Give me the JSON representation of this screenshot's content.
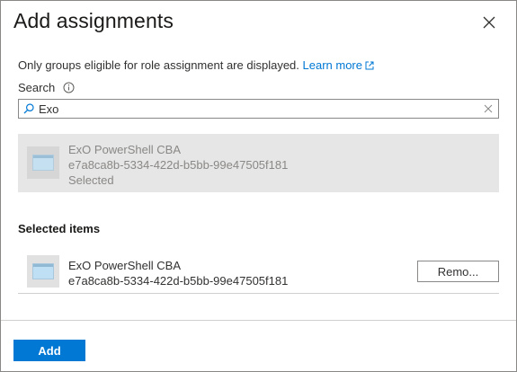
{
  "panel": {
    "title": "Add assignments"
  },
  "info": {
    "text": "Only groups eligible for role assignment are displayed.",
    "link_label": "Learn more"
  },
  "search": {
    "label": "Search",
    "value": "Exo"
  },
  "results": [
    {
      "name": "ExO PowerShell CBA",
      "id": "e7a8ca8b-5334-422d-b5bb-99e47505f181",
      "status": "Selected"
    }
  ],
  "selected_section": {
    "title": "Selected items",
    "items": [
      {
        "name": "ExO PowerShell CBA",
        "id": "e7a8ca8b-5334-422d-b5bb-99e47505f181",
        "remove_label": "Remo..."
      }
    ]
  },
  "footer": {
    "add_label": "Add"
  },
  "colors": {
    "accent": "#0078d4",
    "card_background": "#e6e6e6",
    "border": "#8a8886"
  },
  "icons": [
    "close-icon",
    "external-link-icon",
    "info-icon",
    "search-icon",
    "clear-icon",
    "group-icon"
  ]
}
